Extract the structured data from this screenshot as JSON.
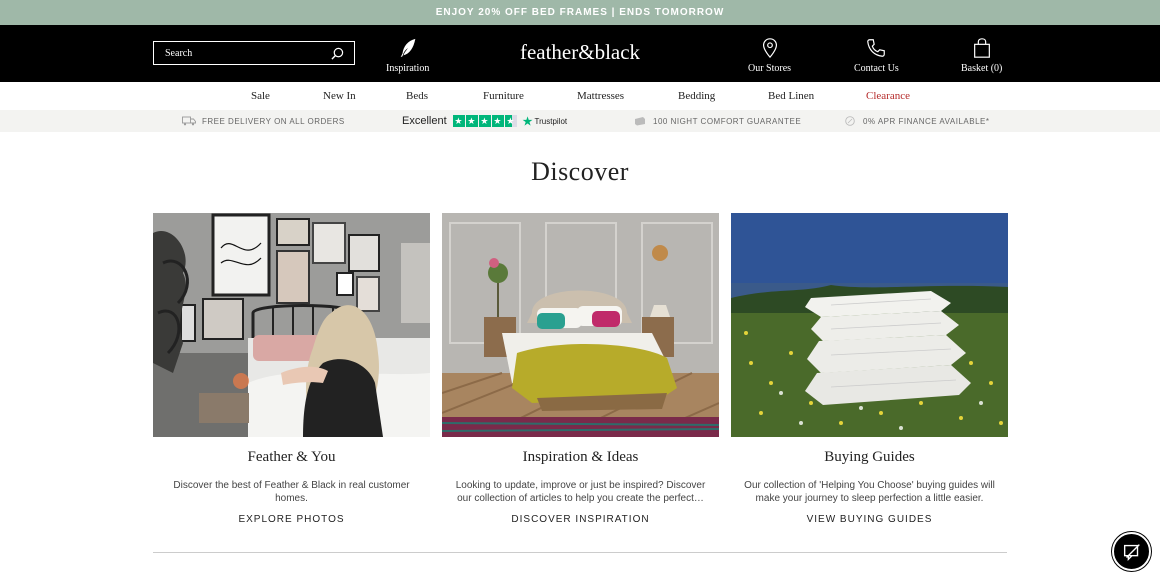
{
  "promo": {
    "text": "ENJOY 20% OFF BED FRAMES | ENDS TOMORROW"
  },
  "header": {
    "search_placeholder": "Search",
    "inspiration_label": "Inspiration",
    "logo_text": "feather&black",
    "stores_label": "Our Stores",
    "contact_label": "Contact Us",
    "basket_label": "Basket (0)"
  },
  "nav": {
    "items": [
      "Sale",
      "New In",
      "Beds",
      "Furniture",
      "Mattresses",
      "Bedding",
      "Bed Linen",
      "Clearance"
    ]
  },
  "usp": {
    "delivery": "FREE DELIVERY ON ALL ORDERS",
    "trustpilot_rating": "Excellent",
    "trustpilot_brand": "Trustpilot",
    "guarantee": "100 NIGHT COMFORT GUARANTEE",
    "finance": "0% APR FINANCE AVAILABLE*"
  },
  "page": {
    "title": "Discover"
  },
  "cards": [
    {
      "title": "Feather & You",
      "description": "Discover the best of Feather & Black in real customer homes.",
      "cta": "EXPLORE PHOTOS"
    },
    {
      "title": "Inspiration & Ideas",
      "description": "Looking to update, improve or just be inspired? Discover our collection of articles to help you create the perfect…",
      "cta": "DISCOVER INSPIRATION"
    },
    {
      "title": "Buying Guides",
      "description": "Our collection of 'Helping You Choose' buying guides will make your journey to sleep perfection a little easier.",
      "cta": "VIEW BUYING GUIDES"
    }
  ],
  "colors": {
    "promo_bg": "#9fb8a8",
    "header_bg": "#000000",
    "clearance": "#b52a2a",
    "trustpilot_green": "#00b67a"
  },
  "icons": {
    "search": "search-icon",
    "inspiration": "feather-icon",
    "stores": "map-pin-icon",
    "contact": "phone-icon",
    "basket": "shopping-bag-icon",
    "chat": "chat-icon"
  }
}
